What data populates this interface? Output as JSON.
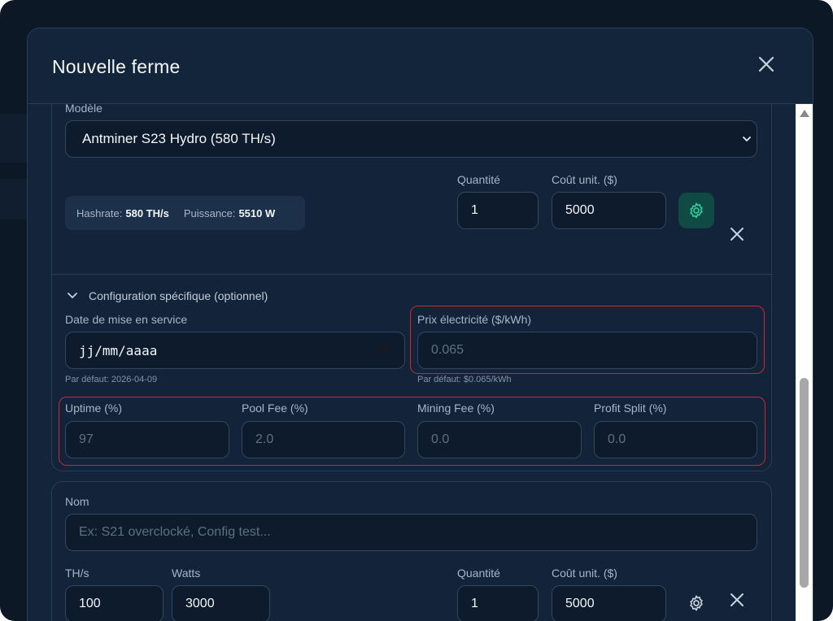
{
  "modal": {
    "title": "Nouvelle ferme"
  },
  "machine1": {
    "model_label": "Modèle",
    "model_value": "Antminer S23 Hydro (580 TH/s)",
    "hashrate_label": "Hashrate:",
    "hashrate_value": "580 TH/s",
    "power_label": "Puissance:",
    "power_value": "5510 W",
    "quantity_label": "Quantité",
    "quantity_value": "1",
    "unit_cost_label": "Coût unit. ($)",
    "unit_cost_value": "5000",
    "config_toggle": "Configuration spécifique (optionnel)",
    "date_label": "Date de mise en service",
    "date_value": "jj/mm/aaaa",
    "date_hint": "Par défaut: 2026-04-09",
    "elec_label": "Prix électricité ($/kWh)",
    "elec_placeholder": "0.065",
    "elec_hint": "Par défaut: $0.065/kWh",
    "uptime_label": "Uptime (%)",
    "uptime_placeholder": "97",
    "pool_fee_label": "Pool Fee (%)",
    "pool_fee_placeholder": "2.0",
    "mining_fee_label": "Mining Fee (%)",
    "mining_fee_placeholder": "0.0",
    "profit_split_label": "Profit Split (%)",
    "profit_split_placeholder": "0.0"
  },
  "machine2": {
    "name_label": "Nom",
    "name_placeholder": "Ex: S21 overclocké, Config test...",
    "ths_label": "TH/s",
    "ths_value": "100",
    "watts_label": "Watts",
    "watts_value": "3000",
    "quantity_label": "Quantité",
    "quantity_value": "1",
    "unit_cost_label": "Coût unit. ($)",
    "unit_cost_value": "5000"
  },
  "colors": {
    "background": "#13253b",
    "accent": "#2ecc9a",
    "highlight": "#c42b34"
  }
}
